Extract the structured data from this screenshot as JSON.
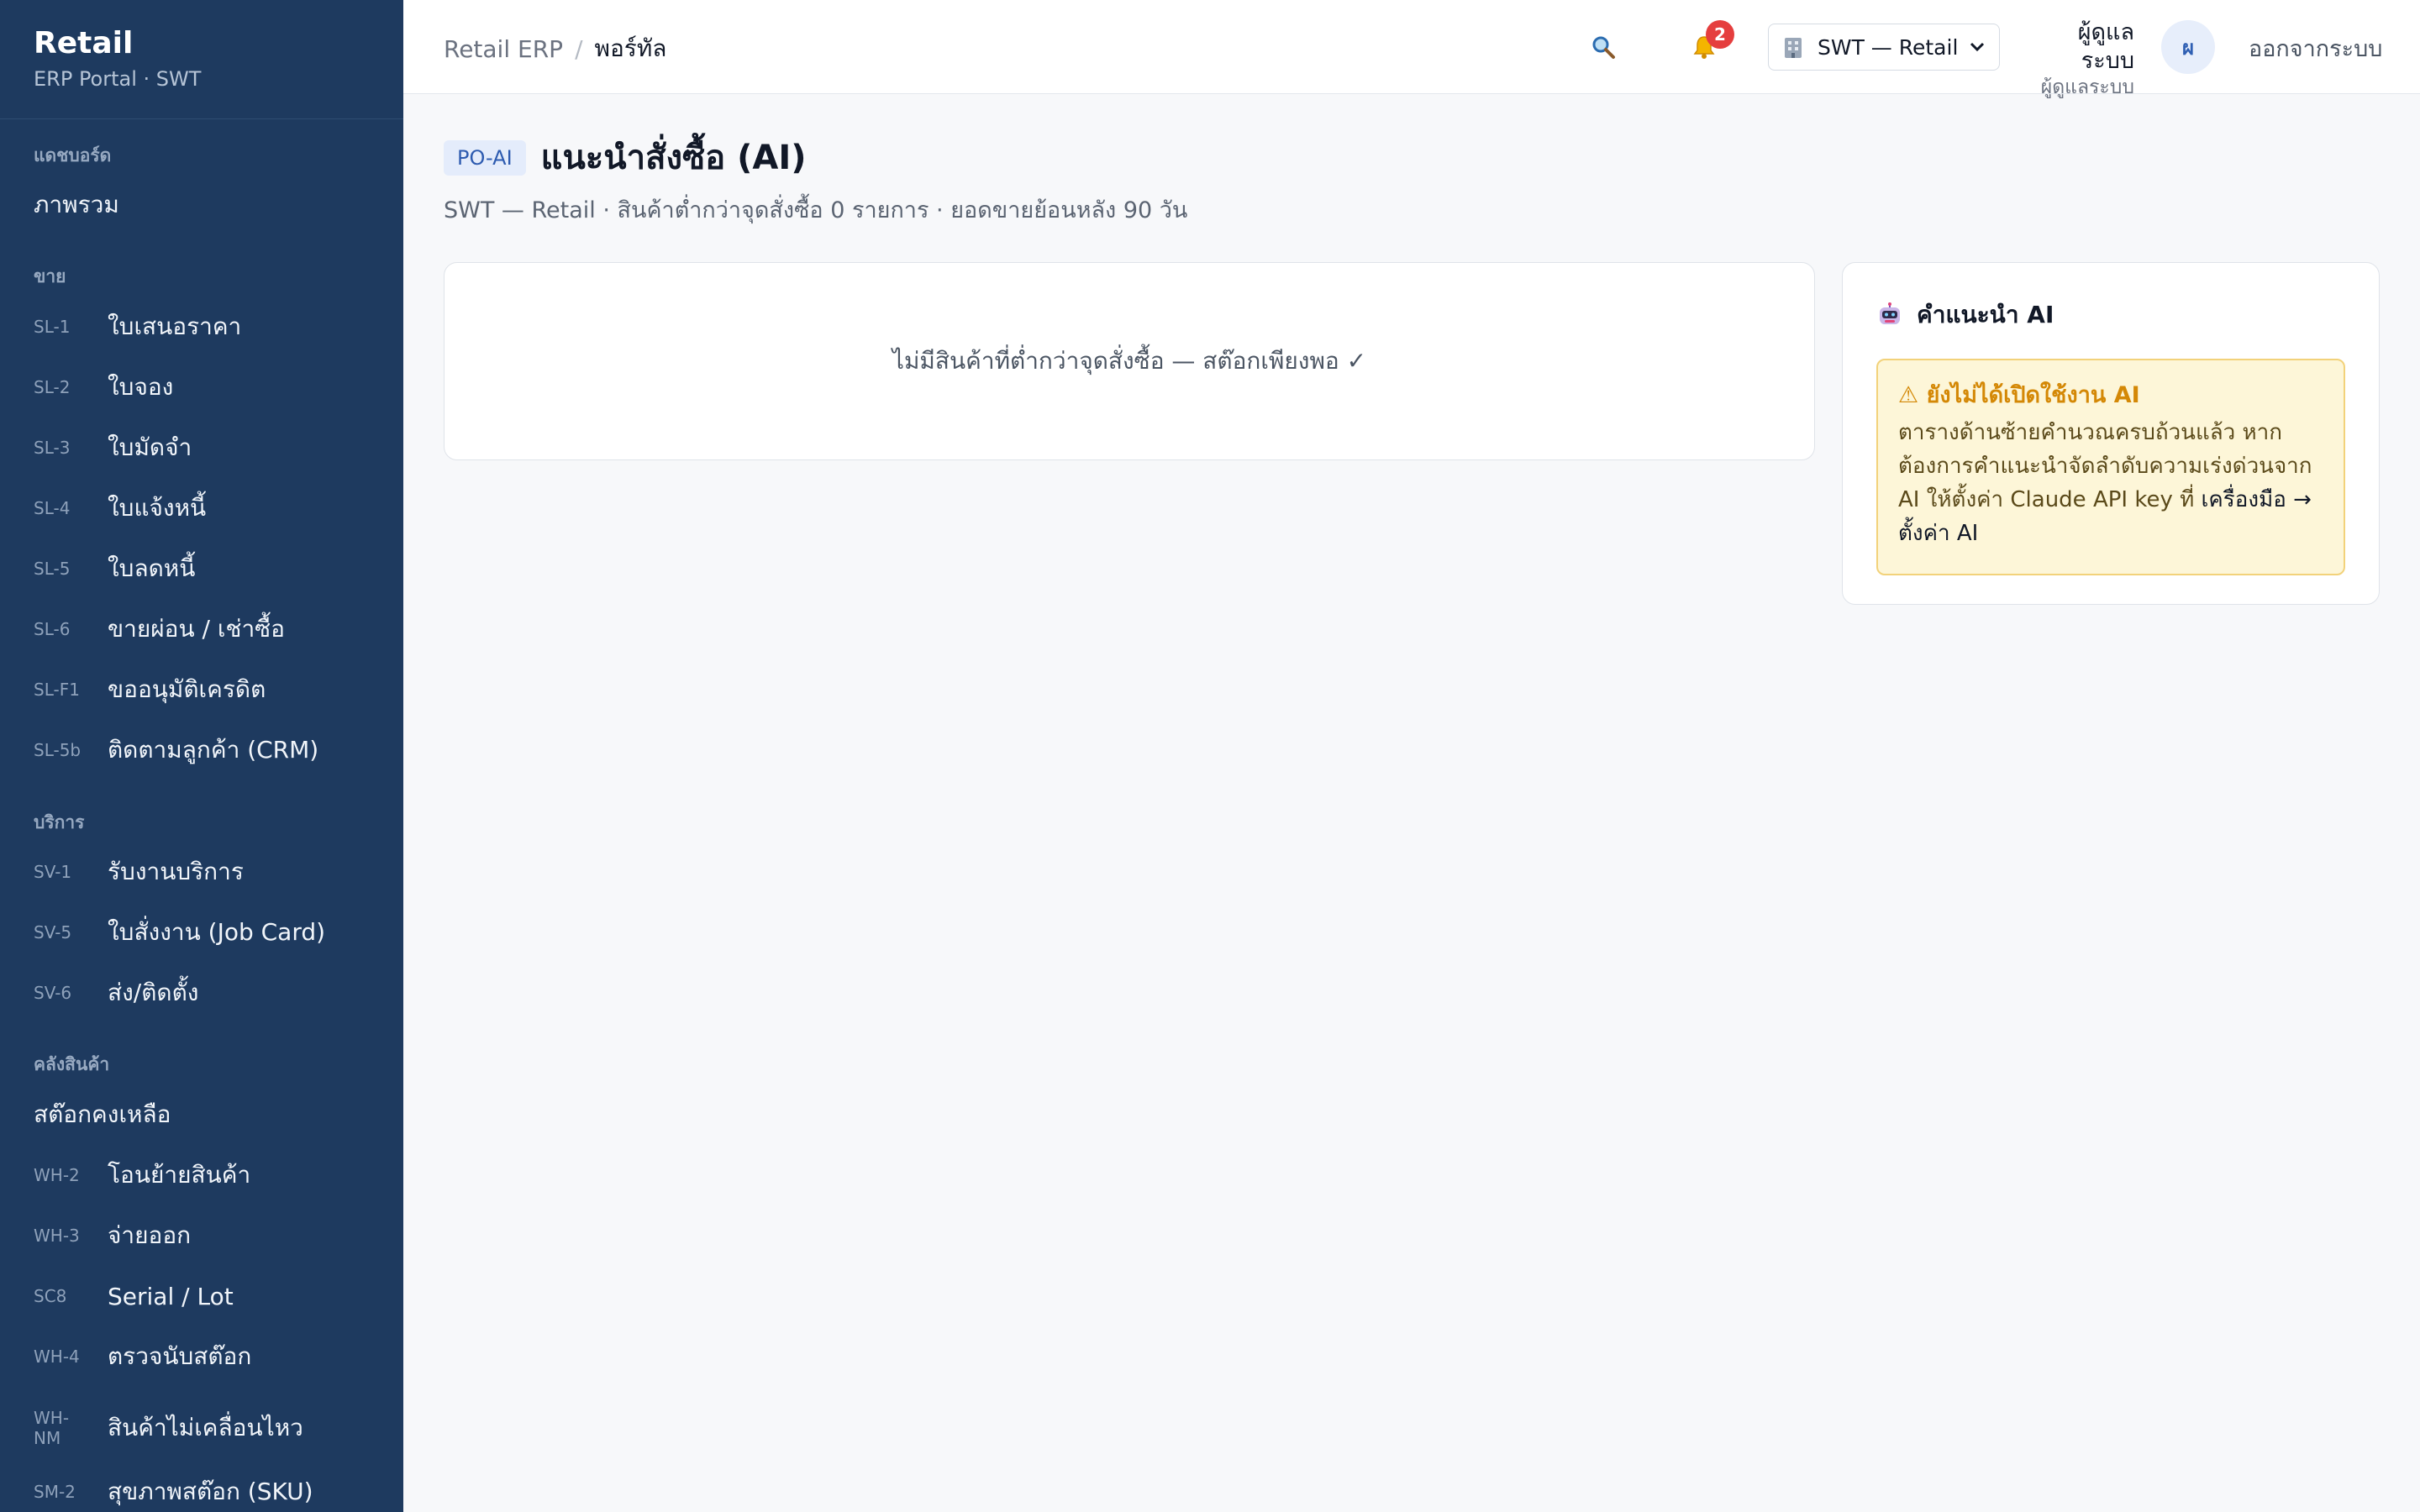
{
  "sidebar": {
    "brand_title": "Retail",
    "brand_sub": "ERP Portal · SWT",
    "sections": {
      "dashboard": "แดชบอร์ด",
      "sales": "ขาย",
      "service": "บริการ",
      "warehouse": "คลังสินค้า"
    },
    "items": [
      {
        "code": "",
        "label": "ภาพรวม"
      },
      {
        "code": "SL-1",
        "label": "ใบเสนอราคา"
      },
      {
        "code": "SL-2",
        "label": "ใบจอง"
      },
      {
        "code": "SL-3",
        "label": "ใบมัดจำ"
      },
      {
        "code": "SL-4",
        "label": "ใบแจ้งหนี้"
      },
      {
        "code": "SL-5",
        "label": "ใบลดหนี้"
      },
      {
        "code": "SL-6",
        "label": "ขายผ่อน / เช่าซื้อ"
      },
      {
        "code": "SL-F1",
        "label": "ขออนุมัติเครดิต"
      },
      {
        "code": "SL-5b",
        "label": "ติดตามลูกค้า (CRM)"
      },
      {
        "code": "SV-1",
        "label": "รับงานบริการ"
      },
      {
        "code": "SV-5",
        "label": "ใบสั่งงาน (Job Card)"
      },
      {
        "code": "SV-6",
        "label": "ส่ง/ติดตั้ง"
      },
      {
        "code": "",
        "label": "สต๊อกคงเหลือ"
      },
      {
        "code": "WH-2",
        "label": "โอนย้ายสินค้า"
      },
      {
        "code": "WH-3",
        "label": "จ่ายออก"
      },
      {
        "code": "SC8",
        "label": "Serial / Lot"
      },
      {
        "code": "WH-4",
        "label": "ตรวจนับสต๊อก"
      },
      {
        "code": "WH-NM",
        "label": "สินค้าไม่เคลื่อนไหว"
      },
      {
        "code": "SM-2",
        "label": "สุขภาพสต๊อก (SKU)"
      }
    ]
  },
  "topbar": {
    "breadcrumb_root": "Retail ERP",
    "breadcrumb_sep": "/",
    "breadcrumb_current": "พอร์ทัล",
    "notification_count": "2",
    "company": "SWT — Retail",
    "user_name": "ผู้ดูแลระบบ",
    "user_role": "ผู้ดูแลระบบ",
    "avatar_initial": "ผ",
    "logout": "ออกจากระบบ",
    "icons": [
      "search-icon",
      "bell-icon",
      "building-icon",
      "chevron-down-icon"
    ]
  },
  "page": {
    "code": "PO-AI",
    "title": "แนะนำสั่งซื้อ (AI)",
    "subtitle": "SWT — Retail · สินค้าต่ำกว่าจุดสั่งซื้อ 0 รายการ · ยอดขายย้อนหลัง 90 วัน",
    "empty_message": "ไม่มีสินค้าที่ต่ำกว่าจุดสั่งซื้อ — สต๊อกเพียงพอ ✓"
  },
  "ai_panel": {
    "title": "คำแนะนำ AI",
    "warning_title": "⚠ ยังไม่ได้เปิดใช้งาน AI",
    "warning_body": "ตารางด้านซ้ายคำนวณครบถ้วนแล้ว หากต้องการคำแนะนำจัดลำดับความเร่งด่วนจาก AI ให้ตั้งค่า Claude API key ที่ ",
    "warning_link": "เครื่องมือ → ตั้งค่า AI"
  },
  "colors": {
    "sidebar_bg": "#1e3a5f",
    "accent": "#2d5bb0",
    "badge": "#e53e3e",
    "warning_bg": "#fdf6d8",
    "warning_text": "#d48806"
  }
}
